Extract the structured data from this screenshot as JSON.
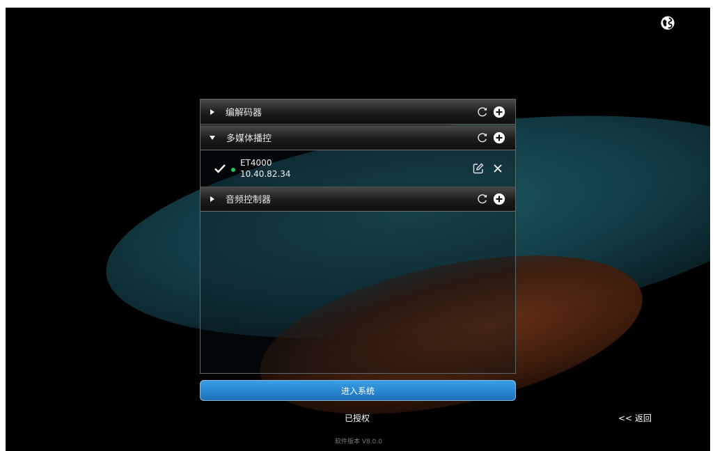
{
  "groups": [
    {
      "title": "编解码器",
      "expanded": false
    },
    {
      "title": "多媒体播控",
      "expanded": true
    },
    {
      "title": "音频控制器",
      "expanded": false
    }
  ],
  "device": {
    "name": "ET4000",
    "ip": "10.40.82.34",
    "status_color": "#22c55e"
  },
  "enter_button": "进入系统",
  "auth_status": "已授权",
  "back_link": "<< 返回",
  "version": "软件版本 V8.0.0",
  "icons": {
    "language": "globe-icon",
    "refresh": "refresh-icon",
    "add": "add-circle-icon",
    "edit": "edit-icon",
    "delete": "close-icon",
    "selected": "checkmark-icon"
  },
  "colors": {
    "button_accent": "#2b86d0",
    "online": "#22c55e"
  }
}
